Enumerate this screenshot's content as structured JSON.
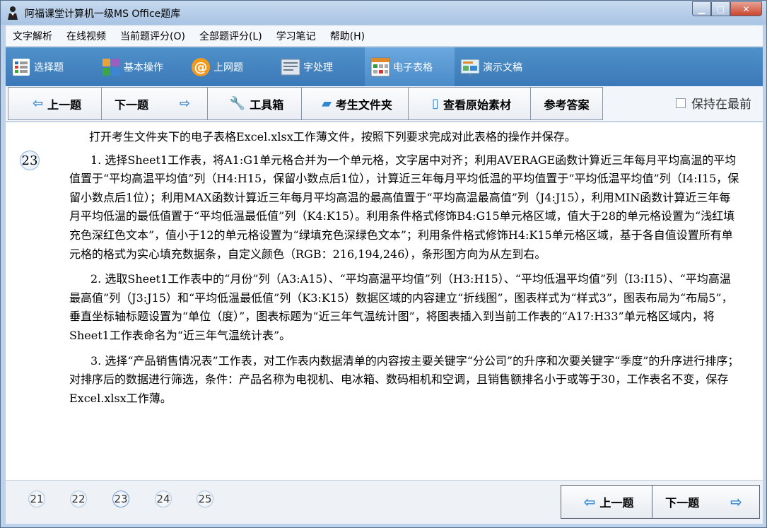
{
  "window": {
    "title": "阿福课堂计算机一级MS Office题库",
    "minimize_glyph": "▁",
    "maximize_glyph": "□",
    "close_glyph": "✕"
  },
  "menu": [
    "文字解析",
    "在线视频",
    "当前题评分(O)",
    "全部题评分(L)",
    "学习笔记",
    "帮助(H)"
  ],
  "nav": [
    {
      "label": "选择题",
      "icon": "choice-grid-icon"
    },
    {
      "label": "基本操作",
      "icon": "colored-blocks-icon"
    },
    {
      "label": "上网题",
      "icon": "at-sign-icon"
    },
    {
      "label": "字处理",
      "icon": "document-icon"
    },
    {
      "label": "电子表格",
      "icon": "spreadsheet-icon",
      "active": true
    },
    {
      "label": "演示文稿",
      "icon": "presentation-icon"
    }
  ],
  "toolbar": {
    "prev": "上一题",
    "next": "下一题",
    "toolbox": "工具箱",
    "student_folder": "考生文件夹",
    "view_material": "查看原始素材",
    "answer": "参考答案",
    "keep_on_top": "保持在最前"
  },
  "question": {
    "number": "23",
    "intro": "打开考生文件夹下的电子表格Excel.xlsx工作薄文件，按照下列要求完成对此表格的操作并保存。",
    "items": [
      "1. 选择Sheet1工作表，将A1:G1单元格合并为一个单元格，文字居中对齐；利用AVERAGE函数计算近三年每月平均高温的平均值置于“平均高温平均值”列（H4:H15，保留小数点后1位），计算近三年每月平均低温的平均值置于“平均低温平均值”列（I4:I15，保留小数点后1位）；利用MAX函数计算近三年每月平均高温的最高值置于“平均高温最高值”列（J4:J15），利用MIN函数计算近三年每月平均低温的最低值置于“平均低温最低值”列（K4:K15）。利用条件格式修饰B4:G15单元格区域，值大于28的单元格设置为“浅红填充色深红色文本”，值小于12的单元格设置为“绿填充色深绿色文本”；利用条件格式修饰H4:K15单元格区域，基于各自值设置所有单元格的格式为实心填充数据条，自定义颜色（RGB：216,194,246），条形图方向为从左到右。",
      "2. 选取Sheet1工作表中的“月份”列（A3:A15）、“平均高温平均值”列（H3:H15）、“平均低温平均值”列（I3:I15）、“平均高温最高值”列（J3:J15）和“平均低温最低值”列（K3:K15）数据区域的内容建立“折线图”，图表样式为“样式3”，图表布局为“布局5”，垂直坐标轴标题设置为“单位（度）”，图表标题为“近三年气温统计图”，将图表插入到当前工作表的“A17:H33”单元格区域内，将Sheet1工作表命名为“近三年气温统计表”。",
      "3. 选择“产品销售情况表”工作表，对工作表内数据清单的内容按主要关键字“分公司”的升序和次要关键字“季度”的升序进行排序；对排序后的数据进行筛选，条件：产品名称为电视机、电冰箱、数码相机和空调，且销售额排名小于或等于30，工作表名不变，保存Excel.xlsx工作薄。"
    ]
  },
  "pager": {
    "pages": [
      "21",
      "22",
      "23",
      "24",
      "25"
    ],
    "current": "23",
    "prev": "上一题",
    "next": "下一题"
  }
}
